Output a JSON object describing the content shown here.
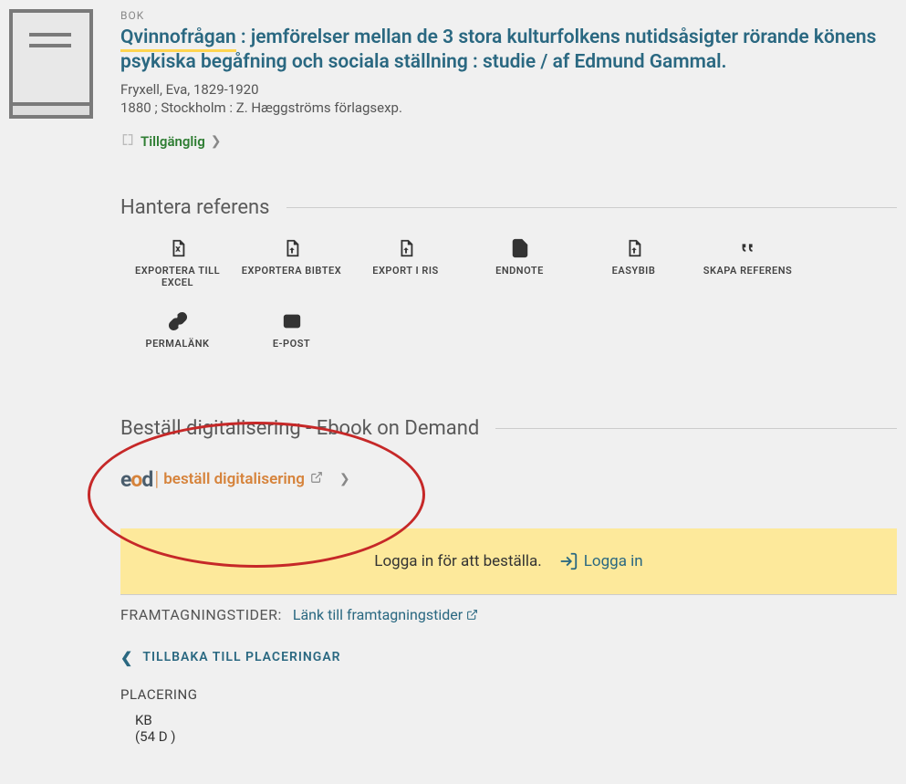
{
  "item": {
    "type_label": "BOK",
    "title_highlight": "Qvinnofrågan",
    "title_rest": " : jemförelser mellan de 3 stora kulturfolkens nutidsåsigter rörande könens psykiska begåfning och sociala ställning : studie / af Edmund Gammal.",
    "author": "Fryxell, Eva, 1829-1920",
    "publication": "1880 ; Stockholm : Z. Hæggströms förlagsexp.",
    "availability": "Tillgänglig"
  },
  "sections": {
    "manage_ref": "Hantera referens",
    "eod": "Beställ digitalisering - Ebook on Demand"
  },
  "actions": [
    {
      "id": "export-excel",
      "label": "EXPORTERA TILL EXCEL",
      "icon": "excel"
    },
    {
      "id": "export-bibtex",
      "label": "EXPORTERA BIBTEX",
      "icon": "file-export"
    },
    {
      "id": "export-ris",
      "label": "EXPORT I RIS",
      "icon": "file-export"
    },
    {
      "id": "endnote",
      "label": "ENDNOTE",
      "icon": "file"
    },
    {
      "id": "easybib",
      "label": "EASYBIB",
      "icon": "file-export"
    },
    {
      "id": "create-ref",
      "label": "SKAPA REFERENS",
      "icon": "quote"
    },
    {
      "id": "permalink",
      "label": "PERMALÄNK",
      "icon": "link"
    },
    {
      "id": "email",
      "label": "E-POST",
      "icon": "mail"
    }
  ],
  "eod": {
    "logo_e": "e",
    "logo_o": "o",
    "logo_d": "d",
    "text": "beställ digitalisering"
  },
  "login_banner": {
    "message": "Logga in för att beställa.",
    "button": "Logga in"
  },
  "framtagning": {
    "label": "FRAMTAGNINGSTIDER:",
    "link": "Länk till framtagningstider"
  },
  "back_link": "TILLBAKA TILL PLACERINGAR",
  "placement": {
    "label": "PLACERING",
    "library": "KB",
    "callno": "(54 D )"
  }
}
